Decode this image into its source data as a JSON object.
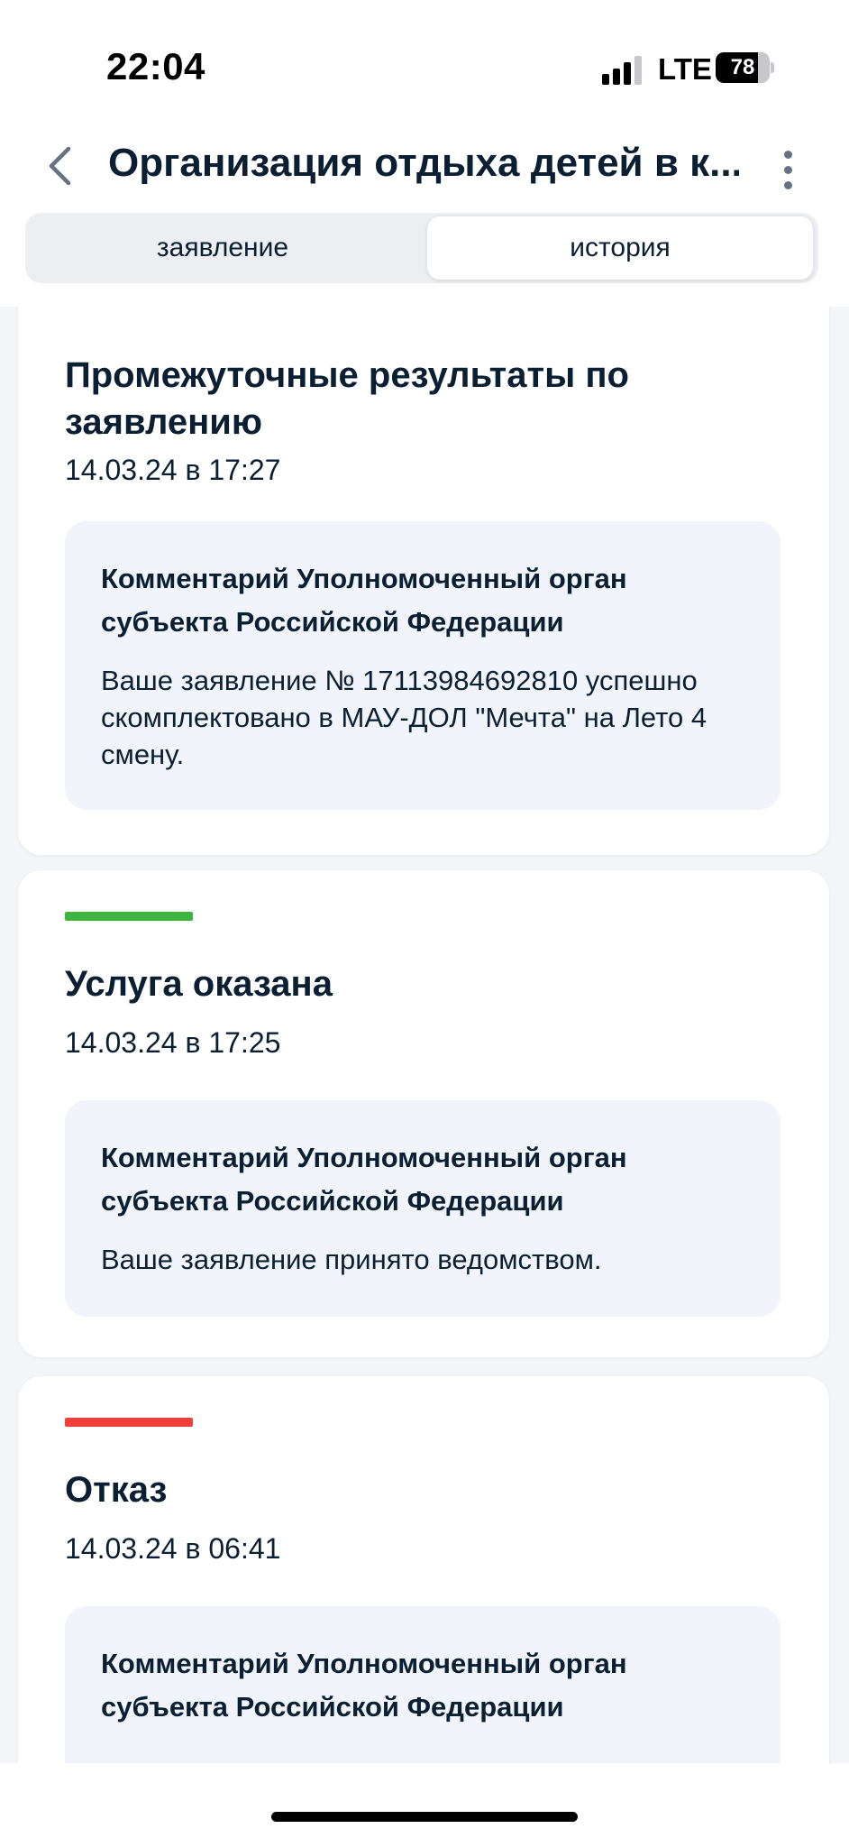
{
  "status_bar": {
    "time": "22:04",
    "network": "LTE",
    "battery_level": "78",
    "battery_fraction": 0.78
  },
  "nav": {
    "title": "Организация отдыха детей в к...",
    "back_icon": "chevron-left-icon",
    "more_icon": "more-vertical-icon"
  },
  "tabs": [
    {
      "label": "заявление",
      "active": false
    },
    {
      "label": "история",
      "active": true
    }
  ],
  "history": [
    {
      "title": "Промежуточные результаты по заявлению",
      "date": "14.03.24 в 17:27",
      "status_color": "",
      "comment_title": "Комментарий Уполномоченный орган субъекта Российской Федерации",
      "comment_text": "Ваше заявление № 17113984692810 успешно скомплектовано в МАУ-ДОЛ \"Мечта\" на Лето 4 смену."
    },
    {
      "title": "Услуга оказана",
      "date": "14.03.24 в 17:25",
      "status_color": "#3cb63c",
      "comment_title": "Комментарий Уполномоченный орган субъекта Российской Федерации",
      "comment_text": "Ваше заявление принято ведомством."
    },
    {
      "title": "Отказ",
      "date": "14.03.24 в 06:41",
      "status_color": "#ee3f3a",
      "comment_title": "Комментарий Уполномоченный орган субъекта Российской Федерации",
      "comment_text": ""
    }
  ]
}
